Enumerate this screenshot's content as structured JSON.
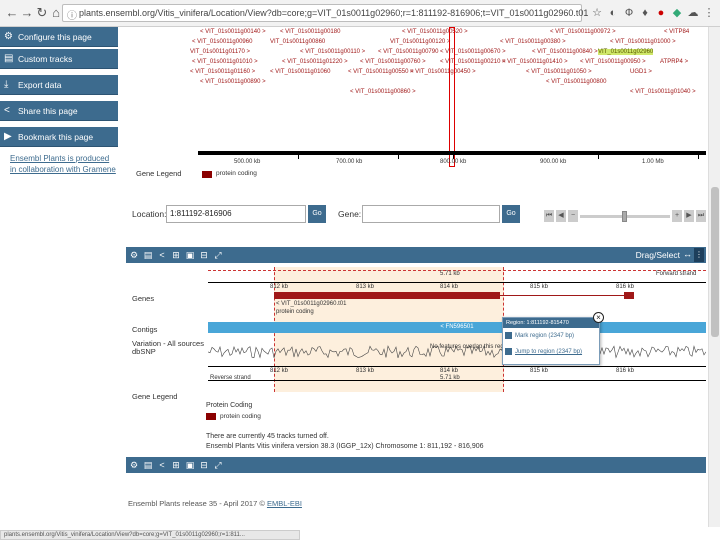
{
  "browser": {
    "url": "plants.ensembl.org/Vitis_vinifera/Location/View?db=core;g=VIT_01s0011g02960;r=1:811192-816906;t=VIT_01s0011g02960.t01",
    "status_url": "plants.ensembl.org/Vitis_vinifera/Location/View?db=core;g=VIT_01s0011g02960;r=1:811..."
  },
  "sidebar": {
    "buttons": [
      {
        "label": "Configure this page",
        "icon": "gear-icon",
        "glyph": "⚙"
      },
      {
        "label": "Custom tracks",
        "icon": "tracks-icon",
        "glyph": "▤"
      },
      {
        "label": "Export data",
        "icon": "export-icon",
        "glyph": "⤓"
      },
      {
        "label": "Share this page",
        "icon": "share-icon",
        "glyph": "<"
      },
      {
        "label": "Bookmark this page",
        "icon": "bookmark-icon",
        "glyph": "▶"
      }
    ],
    "credit": "Ensembl Plants is produced in collaboration with Gramene"
  },
  "overview": {
    "gene_labels": [
      {
        "text": "< VIT_01s0011g00140 >"
      },
      {
        "text": "< VIT_01s0011g00180"
      },
      {
        "text": "< VIT_01s0011g00520 >"
      },
      {
        "text": "< VIT_01s0011g00972 >"
      },
      {
        "text": "< VITP84"
      },
      {
        "text": "< VIT_01s0011g00960"
      },
      {
        "text": "VIT_01s0011g00860"
      },
      {
        "text": "VIT_01s0011g00120 >"
      },
      {
        "text": "< VIT_01s0011g00380 >"
      },
      {
        "text": "< VIT_01s0011g01000 >"
      },
      {
        "text": "VIT_01s0011g01170 >"
      },
      {
        "text": "< VIT_01s0011g00110 >"
      },
      {
        "text": "< VIT_01s0011g00790"
      },
      {
        "text": "< VIT_01s0011g00670 >"
      },
      {
        "text": "< VIT_01s0011g00840 >"
      },
      {
        "text": "VIT_01s0011g02960",
        "highlight": true
      },
      {
        "text": "< VIT_01s0011g01010 >"
      },
      {
        "text": "< VIT_01s0011g01220 >"
      },
      {
        "text": "< VIT_01s0011g00760 >"
      },
      {
        "text": "< VIT_01s0011g00210 >"
      },
      {
        "text": "< VIT_01s0011g01410 >"
      },
      {
        "text": "< VIT_01s0011g00950 >"
      },
      {
        "text": "ATPRP4 >"
      },
      {
        "text": "< VIT_01s0011g01160 >"
      },
      {
        "text": "< VIT_01s0011g01060"
      },
      {
        "text": "< VIT_01s0011g00550 >"
      },
      {
        "text": "< VIT_01s0011g00450 >"
      },
      {
        "text": "< VIT_01s0011g01050 >"
      },
      {
        "text": "UGD1 >"
      },
      {
        "text": "< VIT_01s0011g00890 >"
      },
      {
        "text": "< VIT_01s0011g00860 >"
      },
      {
        "text": "< VIT_01s0011g00800"
      },
      {
        "text": "< VIT_01s0011g01040 >"
      }
    ],
    "tick_labels": [
      "500.00 kb",
      "700.00 kb",
      "800.00 kb",
      "900.00 kb",
      "1.00 Mb"
    ],
    "legend_title": "Gene Legend",
    "legend_item": "protein coding"
  },
  "location": {
    "label": "Location:",
    "value": "1:811192-816906",
    "go": "Go",
    "gene_label": "Gene:",
    "gene_value": "",
    "gene_go": "Go"
  },
  "detail": {
    "toolbar_label": "Drag/Select",
    "forward_strand": "Forward strand",
    "reverse_strand": "Reverse strand",
    "span_label": "5.71 kb",
    "top_ticks": [
      "812 kb",
      "813 kb",
      "814 kb",
      "815 kb",
      "816 kb"
    ],
    "bottom_ticks": [
      "812 kb",
      "813 kb",
      "814 kb",
      "815 kb",
      "816 kb"
    ],
    "tracks": {
      "genes": "Genes",
      "contigs": "Contigs",
      "variation": "Variation - All sources",
      "variation_sub": "dbSNP"
    },
    "gene_name": "< VIT_01s0011g02960.t01",
    "gene_biotype": "protein coding",
    "contig_label": "< FN596501",
    "variation_note": "No features overlap this region",
    "popup": {
      "title": "Region: 1:811192-815470",
      "rows": [
        {
          "label": "Mark region (2347 bp)",
          "icon": "mark-region-icon"
        },
        {
          "label": "Jump to region (2347 bp)",
          "icon": "jump-region-icon"
        }
      ]
    },
    "legend_title": "Gene Legend",
    "legend_group": "Protein Coding",
    "legend_item": "protein coding",
    "info1": "There are currently 45 tracks turned off.",
    "info2": "Ensembl Plants Vitis vinifera version 38.3 (IGGP_12x) Chromosome 1: 811,192 - 816,906"
  },
  "footer": {
    "text": "Ensembl Plants release 35 - April 2017 ©",
    "link": "EMBL-EBI"
  }
}
